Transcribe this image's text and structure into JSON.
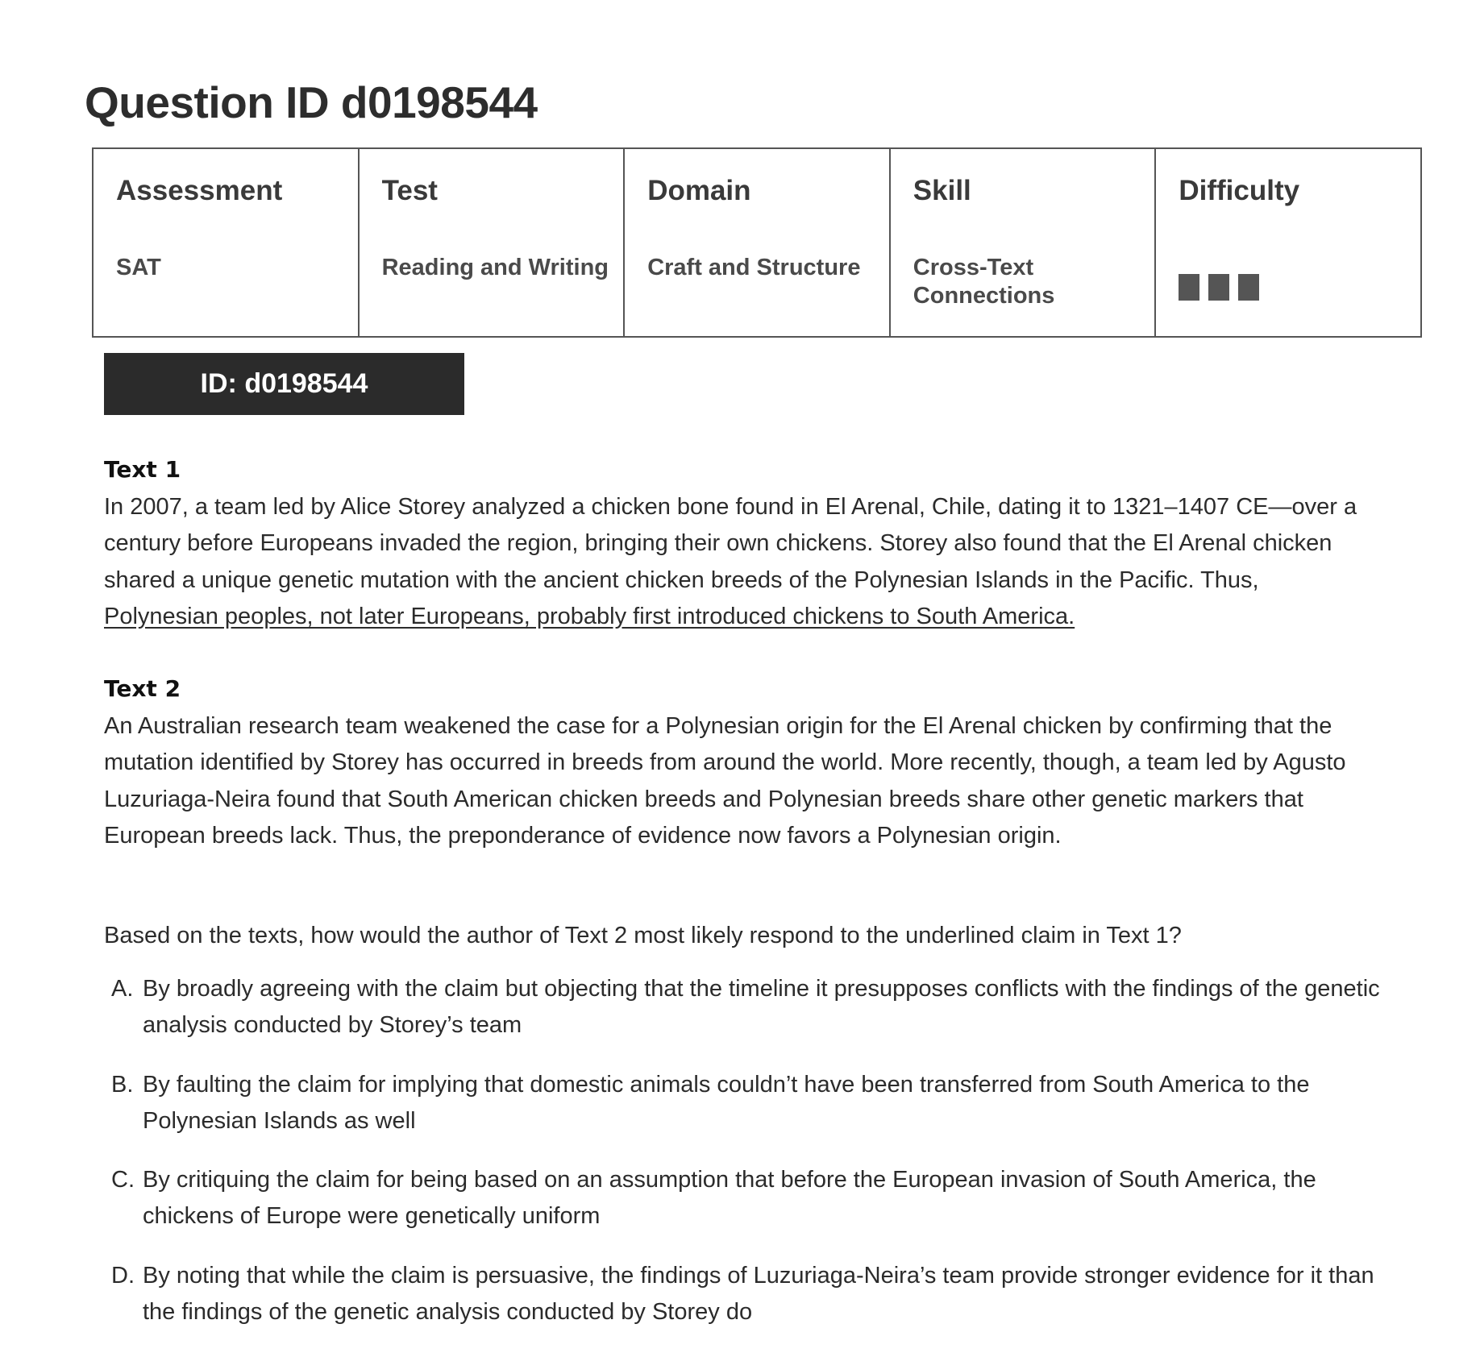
{
  "page_title": "Question ID d0198544",
  "meta": {
    "columns": [
      {
        "header": "Assessment",
        "value": "SAT"
      },
      {
        "header": "Test",
        "value": "Reading and Writing"
      },
      {
        "header": "Domain",
        "value": "Craft and Structure"
      },
      {
        "header": "Skill",
        "value": "Cross-Text Connections"
      },
      {
        "header": "Difficulty",
        "value": ""
      }
    ],
    "difficulty": {
      "filled_bars": 3,
      "total_bars": 3,
      "bar_color": "#555555"
    }
  },
  "id_badge": "ID: d0198544",
  "text1": {
    "label": "Text 1",
    "body": "In 2007, a team led by Alice Storey analyzed a chicken bone found in El Arenal, Chile, dating it to 1321–1407 CE—over a century before Europeans invaded the region, bringing their own chickens. Storey also found that the El Arenal chicken shared a unique genetic mutation with the ancient chicken breeds of the Polynesian Islands in the Pacific. Thus, ",
    "underlined_claim": "Polynesian peoples, not later Europeans, probably first introduced chickens to South America."
  },
  "text2": {
    "label": "Text 2",
    "body": "An Australian research team weakened the case for a Polynesian origin for the El Arenal chicken by confirming that the mutation identified by Storey has occurred in breeds from around the world. More recently, though, a team led by Agusto Luzuriaga-Neira found that South American chicken breeds and Polynesian breeds share other genetic markers that European breeds lack. Thus, the preponderance of evidence now favors a Polynesian origin."
  },
  "question": "Based on the texts, how would the author of Text 2 most likely respond to the underlined claim in Text 1?",
  "choices": [
    {
      "letter": "A.",
      "text": "By broadly agreeing with the claim but objecting that the timeline it presupposes conflicts with the findings of the genetic analysis conducted by Storey’s team"
    },
    {
      "letter": "B.",
      "text": "By faulting the claim for implying that domestic animals couldn’t have been transferred from South America to the Polynesian Islands as well"
    },
    {
      "letter": "C.",
      "text": "By critiquing the claim for being based on an assumption that before the European invasion of South America, the chickens of Europe were genetically uniform"
    },
    {
      "letter": "D.",
      "text": "By noting that while the claim is persuasive, the findings of Luzuriaga-Neira’s team provide stronger evidence for it than the findings of the genetic analysis conducted by Storey do"
    }
  ],
  "colors": {
    "text": "#2b2b2b",
    "badge_background": "#2b2b2b",
    "badge_text": "#ffffff",
    "table_border": "#555555"
  }
}
